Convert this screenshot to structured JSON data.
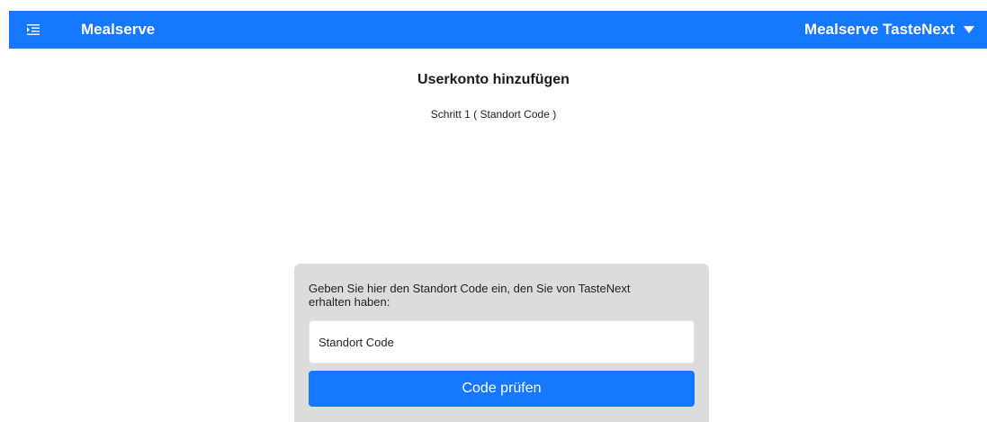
{
  "header": {
    "menu_icon": "menu-icon",
    "brand": "Mealserve",
    "org_selector": "Mealserve TasteNext",
    "org_caret_icon": "caret-down-icon",
    "background_color": "#1677ff"
  },
  "page": {
    "title": "Userkonto hinzufügen",
    "step": "Schritt 1 ( Standort Code )"
  },
  "form": {
    "prompt": "Geben Sie hier den Standort Code ein, den Sie von TasteNext erhalten haben:",
    "code_input": {
      "value": "",
      "placeholder": "Standort Code"
    },
    "submit_label": "Code prüfen",
    "card_color": "#dcdcdc"
  }
}
